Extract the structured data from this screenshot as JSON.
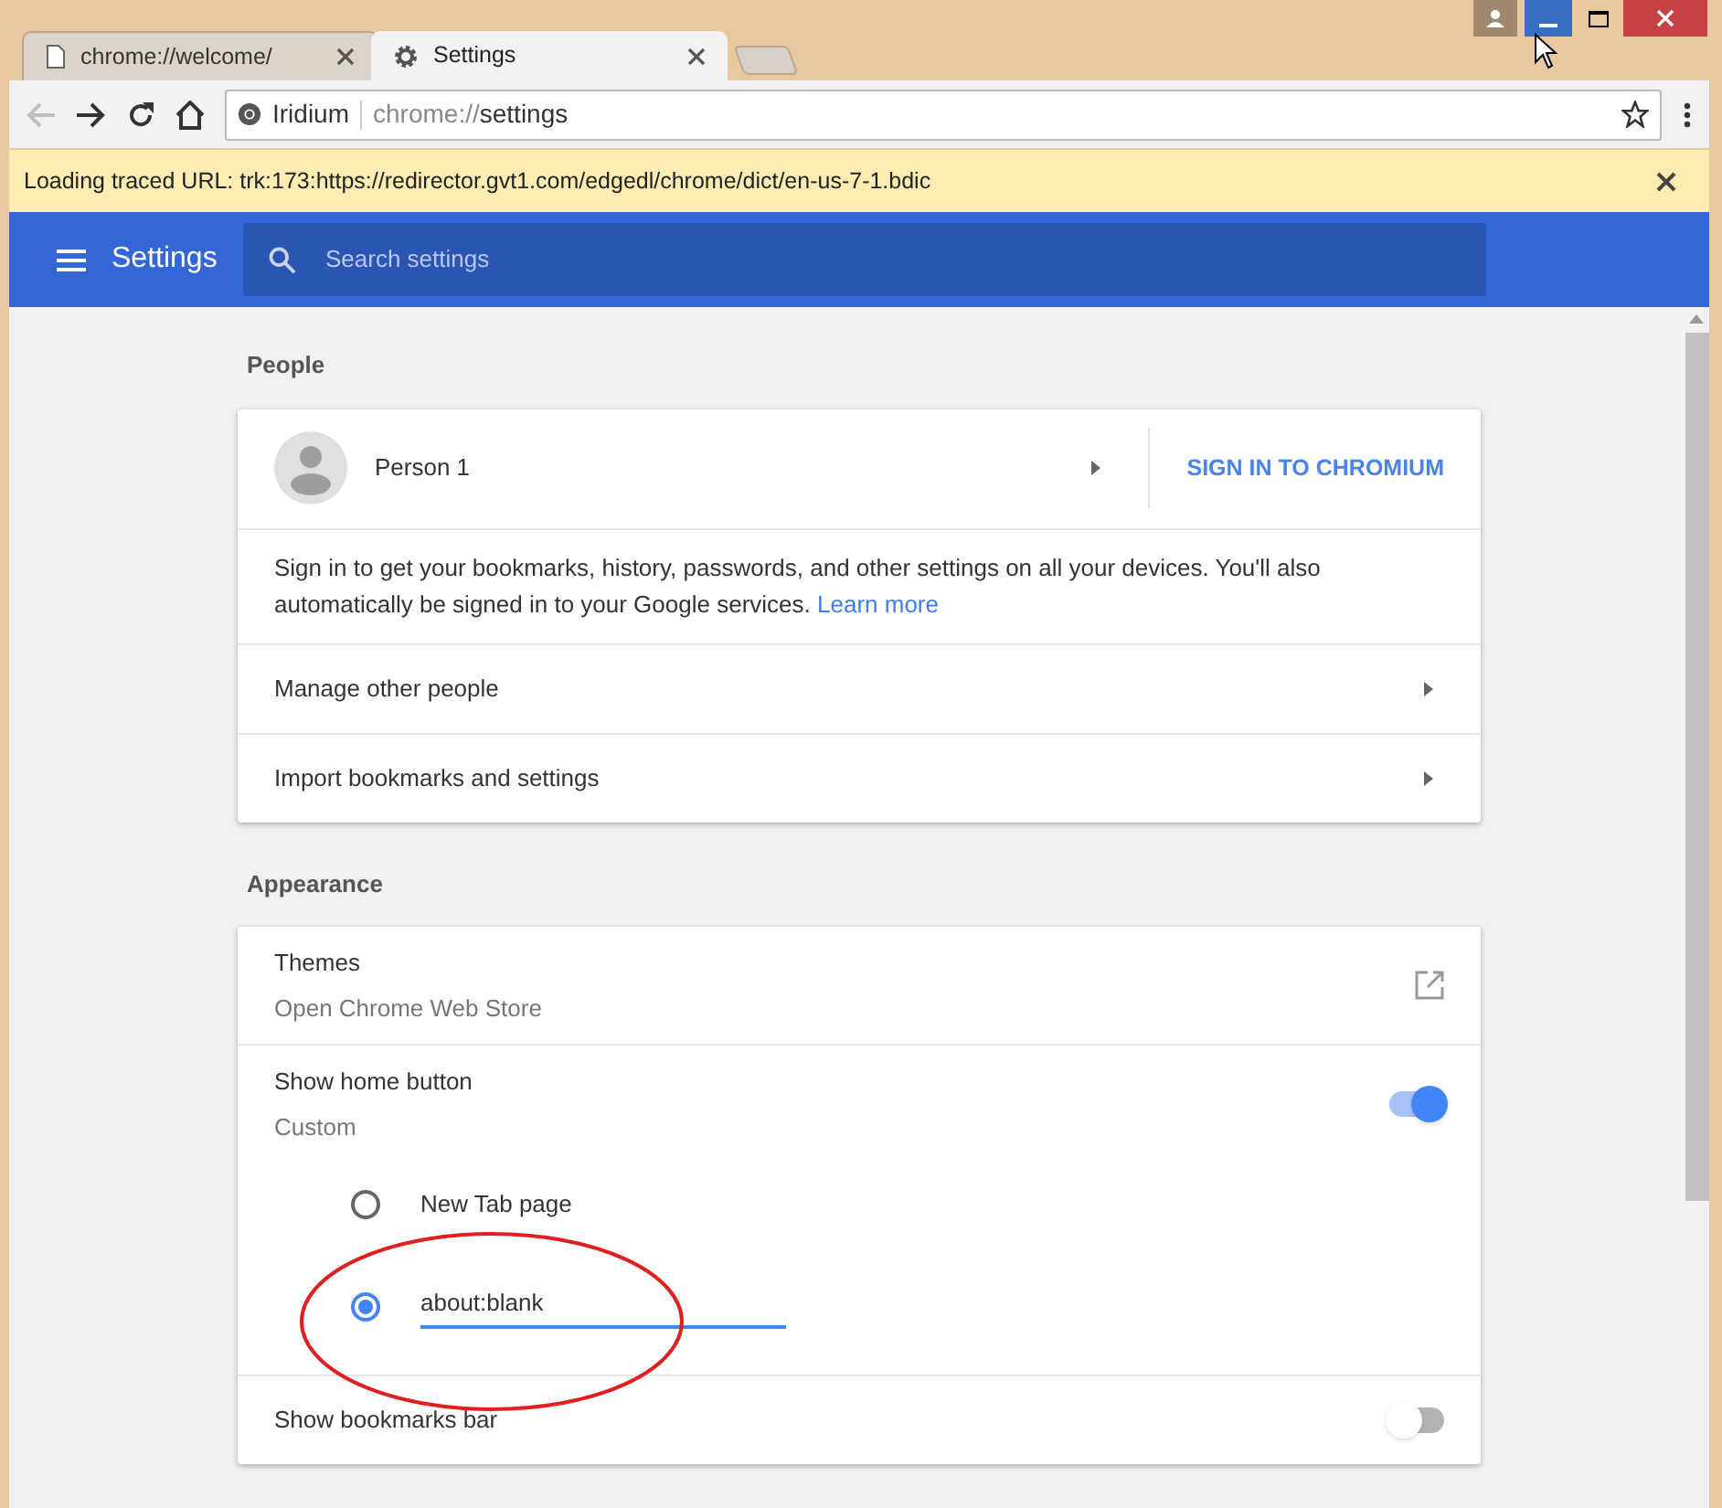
{
  "tabs": [
    {
      "kind": "page",
      "title": "chrome://welcome/",
      "selected": false
    },
    {
      "kind": "settings",
      "title": "Settings",
      "selected": true
    }
  ],
  "omnibox": {
    "site": "Iridium",
    "url_scheme": "chrome://",
    "url_path": "settings"
  },
  "infobar": {
    "text": "Loading traced URL: trk:173:https://redirector.gvt1.com/edgedl/chrome/dict/en-us-7-1.bdic"
  },
  "header": {
    "title": "Settings",
    "search_placeholder": "Search settings"
  },
  "sections": [
    {
      "heading": "People",
      "rows": [
        {
          "kind": "person",
          "name": "Person 1",
          "action": "SIGN IN TO CHROMIUM"
        },
        {
          "kind": "text",
          "text": "Sign in to get your bookmarks, history, passwords, and other settings on all your devices. You'll also automatically be signed in to your Google services.",
          "link": "Learn more"
        },
        {
          "kind": "nav",
          "label": "Manage other people"
        },
        {
          "kind": "nav",
          "label": "Import bookmarks and settings"
        }
      ]
    },
    {
      "heading": "Appearance",
      "rows": [
        {
          "kind": "external",
          "label": "Themes",
          "sublabel": "Open Chrome Web Store"
        },
        {
          "kind": "toggle",
          "label": "Show home button",
          "sublabel": "Custom",
          "on": true,
          "options": [
            {
              "kind": "radio",
              "label": "New Tab page",
              "selected": false
            },
            {
              "kind": "input",
              "value": "about:blank",
              "selected": true
            }
          ]
        },
        {
          "kind": "toggle",
          "label": "Show bookmarks bar",
          "on": false
        }
      ]
    }
  ]
}
